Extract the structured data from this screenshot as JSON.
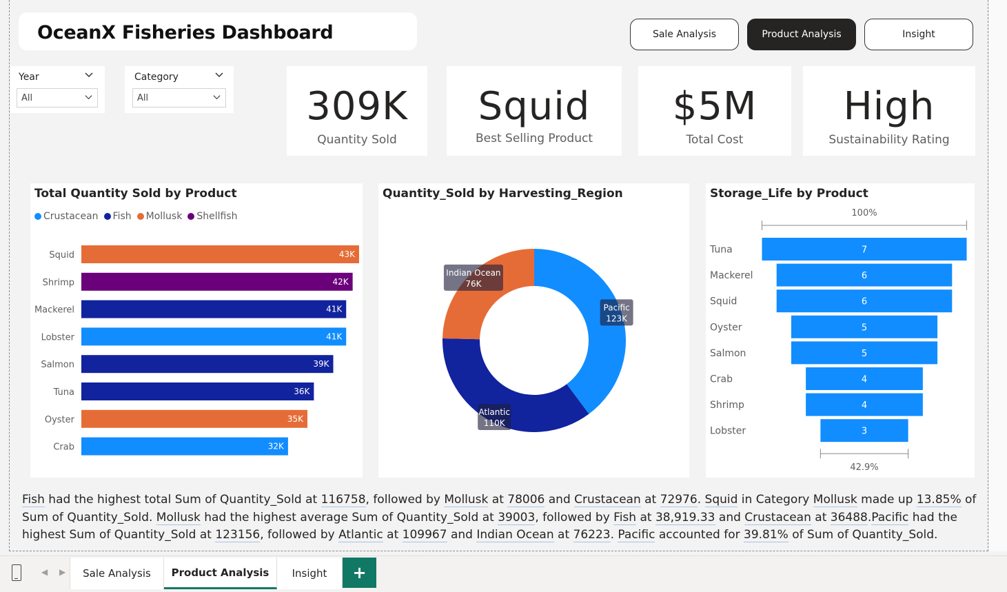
{
  "app": {
    "title": "OceanX Fisheries Dashboard",
    "nav_buttons": [
      {
        "label": "Sale Analysis",
        "active": false
      },
      {
        "label": "Product Analysis",
        "active": true
      },
      {
        "label": "Insight",
        "active": false
      }
    ]
  },
  "filters": {
    "year": {
      "label": "Year",
      "value": "All"
    },
    "category": {
      "label": "Category",
      "value": "All"
    }
  },
  "kpis": [
    {
      "value": "309K",
      "caption": "Quantity Sold"
    },
    {
      "value": "Squid",
      "caption": "Best Selling Product"
    },
    {
      "value": "$5M",
      "caption": "Total Cost"
    },
    {
      "value": "High",
      "caption": "Sustainability Rating"
    }
  ],
  "colors": {
    "Crustacean": "#118dff",
    "Fish": "#12239e",
    "Mollusk": "#e66c37",
    "Shellfish": "#6b007b"
  },
  "bar_panel": {
    "title": "Total Quantity Sold by Product",
    "legend": [
      "Crustacean",
      "Fish",
      "Mollusk",
      "Shellfish"
    ]
  },
  "donut_panel": {
    "title": "Quantity_Sold by Harvesting_Region"
  },
  "funnel_panel": {
    "title": "Storage_Life by Product",
    "top_label": "100%",
    "bottom_label": "42.9%"
  },
  "chart_data": [
    {
      "type": "bar",
      "orientation": "horizontal",
      "title": "Total Quantity Sold by Product",
      "categories": [
        "Squid",
        "Shrimp",
        "Mackerel",
        "Lobster",
        "Salmon",
        "Tuna",
        "Oyster",
        "Crab"
      ],
      "values": [
        43000,
        42000,
        41000,
        41000,
        39000,
        36000,
        35000,
        32000
      ],
      "data_labels": [
        "43K",
        "42K",
        "41K",
        "41K",
        "39K",
        "36K",
        "35K",
        "32K"
      ],
      "series_category": [
        "Mollusk",
        "Shellfish",
        "Fish",
        "Crustacean",
        "Fish",
        "Fish",
        "Mollusk",
        "Crustacean"
      ],
      "legend": [
        "Crustacean",
        "Fish",
        "Mollusk",
        "Shellfish"
      ],
      "legend_position": "top-left"
    },
    {
      "type": "pie",
      "variant": "donut",
      "title": "Quantity_Sold by Harvesting_Region",
      "slices": [
        {
          "label": "Pacific",
          "value": 123156,
          "display": "123K",
          "color": "#118dff"
        },
        {
          "label": "Atlantic",
          "value": 109967,
          "display": "110K",
          "color": "#12239e"
        },
        {
          "label": "Indian Ocean",
          "value": 76223,
          "display": "76K",
          "color": "#e66c37"
        }
      ]
    },
    {
      "type": "bar",
      "variant": "funnel",
      "title": "Storage_Life by Product",
      "categories": [
        "Tuna",
        "Mackerel",
        "Squid",
        "Oyster",
        "Salmon",
        "Crab",
        "Shrimp",
        "Lobster"
      ],
      "values": [
        7,
        6,
        6,
        5,
        5,
        4,
        4,
        3
      ],
      "top_percent": "100%",
      "bottom_percent": "42.9%",
      "color": "#118dff"
    }
  ],
  "narrative": {
    "segments": [
      {
        "t": "Fish",
        "u": true
      },
      {
        "t": " had the highest total Sum of Quantity_Sold at ",
        "u": false
      },
      {
        "t": "116758",
        "u": true
      },
      {
        "t": ", followed by ",
        "u": false
      },
      {
        "t": "Mollusk",
        "u": true
      },
      {
        "t": " at ",
        "u": false
      },
      {
        "t": "78006",
        "u": true
      },
      {
        "t": " and ",
        "u": false
      },
      {
        "t": "Crustacean",
        "u": true
      },
      {
        "t": " at ",
        "u": false
      },
      {
        "t": "72976",
        "u": true
      },
      {
        "t": ". ",
        "u": false
      },
      {
        "t": "Squid",
        "u": true
      },
      {
        "t": " in Category ",
        "u": false
      },
      {
        "t": "Mollusk",
        "u": true
      },
      {
        "t": " made up ",
        "u": false
      },
      {
        "t": "13.85%",
        "u": true
      },
      {
        "t": " of Sum of Quantity_Sold. ",
        "u": false
      },
      {
        "t": "Mollusk",
        "u": true
      },
      {
        "t": " had the highest average Sum of Quantity_Sold at ",
        "u": false
      },
      {
        "t": "39003",
        "u": true
      },
      {
        "t": ", followed by ",
        "u": false
      },
      {
        "t": "Fish",
        "u": true
      },
      {
        "t": " at ",
        "u": false
      },
      {
        "t": "38,919.33",
        "u": true
      },
      {
        "t": " and ",
        "u": false
      },
      {
        "t": "Crustacean",
        "u": true
      },
      {
        "t": " at ",
        "u": false
      },
      {
        "t": "36488",
        "u": true
      },
      {
        "t": ".",
        "u": false
      },
      {
        "t": "Pacific",
        "u": true
      },
      {
        "t": " had the highest Sum of Quantity_Sold at ",
        "u": false
      },
      {
        "t": "123156",
        "u": true
      },
      {
        "t": ", followed by ",
        "u": false
      },
      {
        "t": "Atlantic",
        "u": true
      },
      {
        "t": " at ",
        "u": false
      },
      {
        "t": "109967",
        "u": true
      },
      {
        "t": " and ",
        "u": false
      },
      {
        "t": "Indian Ocean",
        "u": true
      },
      {
        "t": " at ",
        "u": false
      },
      {
        "t": "76223",
        "u": true
      },
      {
        "t": ". ",
        "u": false
      },
      {
        "t": "Pacific",
        "u": true
      },
      {
        "t": " accounted for ",
        "u": false
      },
      {
        "t": "39.81%",
        "u": true
      },
      {
        "t": " of Sum of Quantity_Sold.",
        "u": false
      }
    ]
  },
  "tabs": [
    {
      "label": "Sale Analysis",
      "active": false
    },
    {
      "label": "Product Analysis",
      "active": true
    },
    {
      "label": "Insight",
      "active": false
    }
  ],
  "tab_add": "+",
  "icons": {
    "device": "phone-layout-icon",
    "prev": "chevron-left-icon",
    "next": "chevron-right-icon",
    "dropdown": "chevron-down-icon"
  }
}
